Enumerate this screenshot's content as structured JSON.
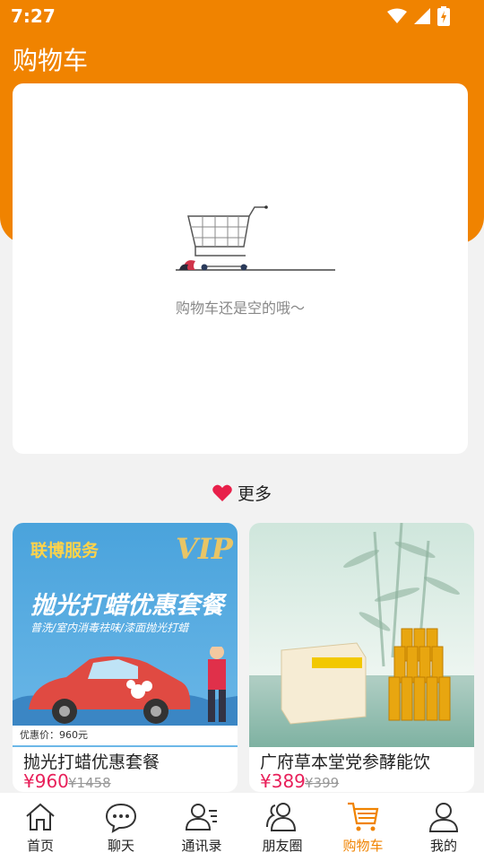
{
  "status": {
    "time": "7:27"
  },
  "header": {
    "title": "购物车"
  },
  "empty_cart": {
    "message": "购物车还是空的哦～"
  },
  "more": {
    "label": "更多"
  },
  "products": [
    {
      "name": "抛光打蜡优惠套餐",
      "price": "¥960",
      "original_price": "¥1458",
      "banner": {
        "brand": "联博服务",
        "vip": "VIP",
        "title": "抛光打蜡优惠套餐",
        "subtitle": "普洗/室内消毒祛味/漆面抛光打蜡",
        "price_tag": "优惠价：960元"
      }
    },
    {
      "name": "广府草本堂党参酵能饮",
      "price": "¥389",
      "original_price": "¥399"
    }
  ],
  "tabbar": {
    "items": [
      {
        "label": "首页",
        "icon": "home-icon"
      },
      {
        "label": "聊天",
        "icon": "chat-icon"
      },
      {
        "label": "通讯录",
        "icon": "contacts-icon"
      },
      {
        "label": "朋友圈",
        "icon": "friends-icon"
      },
      {
        "label": "购物车",
        "icon": "cart-icon",
        "active": true
      },
      {
        "label": "我的",
        "icon": "profile-icon"
      }
    ]
  },
  "colors": {
    "accent": "#f08300",
    "price": "#e8205a",
    "heart": "#e8204a"
  }
}
